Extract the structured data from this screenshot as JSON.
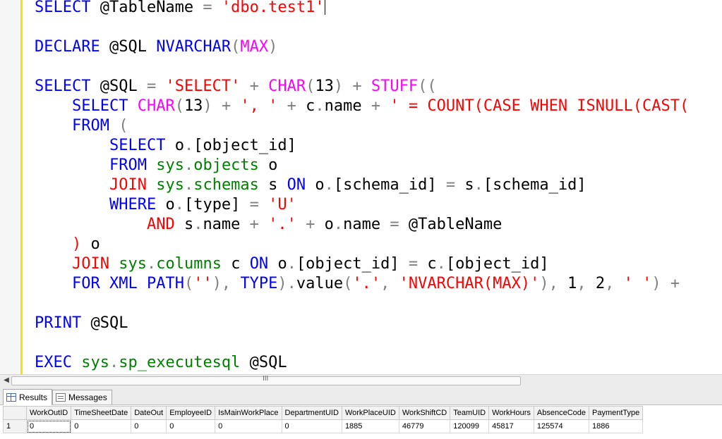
{
  "editor": {
    "lines": [
      [
        {
          "t": "SELECT ",
          "c": "kw"
        },
        {
          "t": "@TableName ",
          "c": ""
        },
        {
          "t": "= ",
          "c": "op"
        },
        {
          "t": "'dbo.test1'",
          "c": "str"
        }
      ],
      [],
      [
        {
          "t": "DECLARE ",
          "c": "kw"
        },
        {
          "t": "@SQL ",
          "c": ""
        },
        {
          "t": "NVARCHAR",
          "c": "kw"
        },
        {
          "t": "(",
          "c": "op"
        },
        {
          "t": "MAX",
          "c": "fn"
        },
        {
          "t": ")",
          "c": "op"
        }
      ],
      [],
      [
        {
          "t": "SELECT ",
          "c": "kw"
        },
        {
          "t": "@SQL ",
          "c": ""
        },
        {
          "t": "= ",
          "c": "op"
        },
        {
          "t": "'SELECT' ",
          "c": "str"
        },
        {
          "t": "+ ",
          "c": "op"
        },
        {
          "t": "CHAR",
          "c": "fn"
        },
        {
          "t": "(",
          "c": "op"
        },
        {
          "t": "13",
          "c": ""
        },
        {
          "t": ") ",
          "c": "op"
        },
        {
          "t": "+ ",
          "c": "op"
        },
        {
          "t": "STUFF",
          "c": "fn"
        },
        {
          "t": "((",
          "c": "op"
        }
      ],
      [
        {
          "t": "    ",
          "c": ""
        },
        {
          "t": "SELECT ",
          "c": "kw"
        },
        {
          "t": "CHAR",
          "c": "fn"
        },
        {
          "t": "(",
          "c": "op"
        },
        {
          "t": "13",
          "c": ""
        },
        {
          "t": ") ",
          "c": "op"
        },
        {
          "t": "+ ",
          "c": "op"
        },
        {
          "t": "', ' ",
          "c": "str"
        },
        {
          "t": "+ ",
          "c": "op"
        },
        {
          "t": "c",
          "c": ""
        },
        {
          "t": ".",
          "c": "op"
        },
        {
          "t": "name ",
          "c": ""
        },
        {
          "t": "+ ",
          "c": "op"
        },
        {
          "t": "' = COUNT(CASE WHEN ISNULL(CAST(",
          "c": "str"
        }
      ],
      [
        {
          "t": "    ",
          "c": ""
        },
        {
          "t": "FROM ",
          "c": "kw"
        },
        {
          "t": "(",
          "c": "op"
        }
      ],
      [
        {
          "t": "        ",
          "c": ""
        },
        {
          "t": "SELECT ",
          "c": "kw"
        },
        {
          "t": "o",
          "c": ""
        },
        {
          "t": ".",
          "c": "op"
        },
        {
          "t": "[object_id]",
          "c": ""
        }
      ],
      [
        {
          "t": "        ",
          "c": ""
        },
        {
          "t": "FROM ",
          "c": "kw"
        },
        {
          "t": "sys",
          "c": "gr"
        },
        {
          "t": ".",
          "c": "op"
        },
        {
          "t": "objects ",
          "c": "gr"
        },
        {
          "t": "o",
          "c": ""
        }
      ],
      [
        {
          "t": "        ",
          "c": ""
        },
        {
          "t": "JOIN ",
          "c": "fnr"
        },
        {
          "t": "sys",
          "c": "gr"
        },
        {
          "t": ".",
          "c": "op"
        },
        {
          "t": "schemas ",
          "c": "gr"
        },
        {
          "t": "s ",
          "c": ""
        },
        {
          "t": "ON ",
          "c": "kw"
        },
        {
          "t": "o",
          "c": ""
        },
        {
          "t": ".",
          "c": "op"
        },
        {
          "t": "[schema_id] ",
          "c": ""
        },
        {
          "t": "= ",
          "c": "op"
        },
        {
          "t": "s",
          "c": ""
        },
        {
          "t": ".",
          "c": "op"
        },
        {
          "t": "[schema_id]",
          "c": ""
        }
      ],
      [
        {
          "t": "        ",
          "c": ""
        },
        {
          "t": "WHERE ",
          "c": "kw"
        },
        {
          "t": "o",
          "c": ""
        },
        {
          "t": ".",
          "c": "op"
        },
        {
          "t": "[type] ",
          "c": ""
        },
        {
          "t": "= ",
          "c": "op"
        },
        {
          "t": "'U'",
          "c": "str"
        }
      ],
      [
        {
          "t": "            ",
          "c": ""
        },
        {
          "t": "AND ",
          "c": "fnr"
        },
        {
          "t": "s",
          "c": ""
        },
        {
          "t": ".",
          "c": "op"
        },
        {
          "t": "name ",
          "c": ""
        },
        {
          "t": "+ ",
          "c": "op"
        },
        {
          "t": "'.' ",
          "c": "str"
        },
        {
          "t": "+ ",
          "c": "op"
        },
        {
          "t": "o",
          "c": ""
        },
        {
          "t": ".",
          "c": "op"
        },
        {
          "t": "name ",
          "c": ""
        },
        {
          "t": "= ",
          "c": "op"
        },
        {
          "t": "@TableName",
          "c": ""
        }
      ],
      [
        {
          "t": "    ",
          "c": ""
        },
        {
          "t": ") ",
          "c": "fnr"
        },
        {
          "t": "o",
          "c": ""
        }
      ],
      [
        {
          "t": "    ",
          "c": ""
        },
        {
          "t": "JOIN ",
          "c": "fnr"
        },
        {
          "t": "sys",
          "c": "gr"
        },
        {
          "t": ".",
          "c": "op"
        },
        {
          "t": "columns ",
          "c": "gr"
        },
        {
          "t": "c ",
          "c": ""
        },
        {
          "t": "ON ",
          "c": "kw"
        },
        {
          "t": "o",
          "c": ""
        },
        {
          "t": ".",
          "c": "op"
        },
        {
          "t": "[object_id] ",
          "c": ""
        },
        {
          "t": "= ",
          "c": "op"
        },
        {
          "t": "c",
          "c": ""
        },
        {
          "t": ".",
          "c": "op"
        },
        {
          "t": "[object_id]",
          "c": ""
        }
      ],
      [
        {
          "t": "    ",
          "c": ""
        },
        {
          "t": "FOR ",
          "c": "kw"
        },
        {
          "t": "XML ",
          "c": "kw"
        },
        {
          "t": "PATH",
          "c": "kw"
        },
        {
          "t": "(",
          "c": "op"
        },
        {
          "t": "''",
          "c": "str"
        },
        {
          "t": "), ",
          "c": "op"
        },
        {
          "t": "TYPE",
          "c": "kw"
        },
        {
          "t": ").",
          "c": "op"
        },
        {
          "t": "value",
          "c": ""
        },
        {
          "t": "(",
          "c": "op"
        },
        {
          "t": "'.'",
          "c": "str"
        },
        {
          "t": ", ",
          "c": "op"
        },
        {
          "t": "'NVARCHAR(MAX)'",
          "c": "str"
        },
        {
          "t": "), ",
          "c": "op"
        },
        {
          "t": "1",
          "c": ""
        },
        {
          "t": ", ",
          "c": "op"
        },
        {
          "t": "2",
          "c": ""
        },
        {
          "t": ", ",
          "c": "op"
        },
        {
          "t": "' '",
          "c": "str"
        },
        {
          "t": ") ",
          "c": "op"
        },
        {
          "t": "+",
          "c": "op"
        }
      ],
      [],
      [
        {
          "t": "PRINT ",
          "c": "kw"
        },
        {
          "t": "@SQL",
          "c": ""
        }
      ],
      [],
      [
        {
          "t": "EXEC ",
          "c": "kw"
        },
        {
          "t": "sys",
          "c": "gr"
        },
        {
          "t": ".",
          "c": "op"
        },
        {
          "t": "sp_executesql ",
          "c": "gr"
        },
        {
          "t": "@SQL",
          "c": ""
        }
      ]
    ]
  },
  "scrollbar": {
    "grip": "III"
  },
  "tabs": {
    "results": "Results",
    "messages": "Messages"
  },
  "grid": {
    "columns": [
      "WorkOutID",
      "TimeSheetDate",
      "DateOut",
      "EmployeeID",
      "IsMainWorkPlace",
      "DepartmentUID",
      "WorkPlaceUID",
      "WorkShiftCD",
      "TeamUID",
      "WorkHours",
      "AbsenceCode",
      "PaymentType"
    ],
    "rows": [
      {
        "num": "1",
        "cells": [
          "0",
          "0",
          "0",
          "0",
          "0",
          "0",
          "1885",
          "46779",
          "120099",
          "45817",
          "125574",
          "1886"
        ]
      }
    ]
  }
}
